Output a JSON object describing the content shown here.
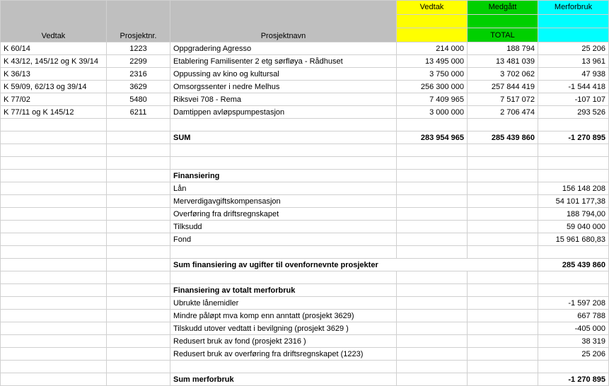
{
  "header": {
    "vedtak": "Vedtak",
    "prosjektnr": "Prosjektnr.",
    "prosjektnavn": "Prosjektnavn",
    "col_vedtak": "Vedtak",
    "col_medgatt": "Medgått",
    "col_merforbruk": "Merforbruk",
    "col_total": "TOTAL"
  },
  "rows": [
    {
      "vedtak": "K 60/14",
      "proj": "1223",
      "name": "Oppgradering Agresso",
      "v": "214 000",
      "m": "188 794",
      "f": "25 206"
    },
    {
      "vedtak": "K 43/12, 145/12 og K 39/14",
      "proj": "2299",
      "name": "Etablering Familisenter 2 etg sørfløya - Rådhuset",
      "v": "13 495 000",
      "m": "13 481 039",
      "f": "13 961"
    },
    {
      "vedtak": "K 36/13",
      "proj": "2316",
      "name": "Oppussing av kino og kultursal",
      "v": "3 750 000",
      "m": "3 702 062",
      "f": "47 938"
    },
    {
      "vedtak": "K 59/09, 62/13 og 39/14",
      "proj": "3629",
      "name": "Omsorgssenter i nedre Melhus",
      "v": "256 300 000",
      "m": "257 844 419",
      "f": "-1 544 418"
    },
    {
      "vedtak": "K 77/02",
      "proj": "5480",
      "name": "Riksvei 708 - Rema",
      "v": "7 409 965",
      "m": "7 517 072",
      "f": "-107 107"
    },
    {
      "vedtak": "K 77/11 og K 145/12",
      "proj": "6211",
      "name": "Damtippen avløpspumpestasjon",
      "v": "3 000 000",
      "m": "2 706 474",
      "f": "293 526"
    }
  ],
  "sum": {
    "label": "SUM",
    "v": "283 954 965",
    "m": "285 439 860",
    "f": "-1 270 895"
  },
  "fin": {
    "title": "Finansiering",
    "items": [
      {
        "name": "Lån",
        "val": "156 148 208"
      },
      {
        "name": "Merverdigavgiftskompensasjon",
        "val": "54 101 177,38"
      },
      {
        "name": "Overføring fra driftsregnskapet",
        "val": "188 794,00"
      },
      {
        "name": "Tilksudd",
        "val": "59 040 000"
      },
      {
        "name": "Fond",
        "val": "15 961 680,83"
      }
    ],
    "sum_label": "Sum finansiering av ugifter til ovenfornevnte prosjekter",
    "sum_val": "285 439 860"
  },
  "mer": {
    "title": "Finansiering av totalt merforbruk",
    "items": [
      {
        "name": "Ubrukte lånemidler",
        "val": "-1 597 208"
      },
      {
        "name": "Mindre påløpt mva komp enn anntatt (prosjekt 3629)",
        "val": "667 788"
      },
      {
        "name": "Tilskudd utover vedtatt i bevilgning (prosjekt 3629 )",
        "val": "-405 000"
      },
      {
        "name": "Redusert bruk av fond (prosjekt 2316 )",
        "val": "38 319"
      },
      {
        "name": "Redusert bruk av overføring fra driftsregnskapet (1223)",
        "val": "25 206"
      }
    ],
    "sum_label": "Sum merforbruk",
    "sum_val": "-1 270 895"
  }
}
